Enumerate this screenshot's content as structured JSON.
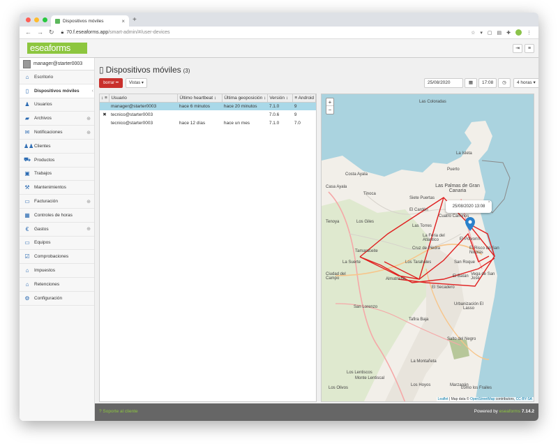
{
  "browser": {
    "tab_title": "Dispositivos móviles",
    "url_host": "70.f.eseaforms.app",
    "url_path": "/smart-admin/#/user-devices"
  },
  "app": {
    "logo": "eseaforms",
    "user": "manager@starter0003"
  },
  "sidebar": {
    "items": [
      {
        "label": "Escritorio",
        "icon": "home-icon",
        "plus": false
      },
      {
        "label": "Dispositivos móviles",
        "icon": "mobile-icon",
        "plus": false,
        "active": true
      },
      {
        "label": "Usuarios",
        "icon": "user-icon",
        "plus": false
      },
      {
        "label": "Archivos",
        "icon": "folder-icon",
        "plus": true
      },
      {
        "label": "Notificaciones",
        "icon": "envelope-icon",
        "plus": true
      },
      {
        "label": "Clientes",
        "icon": "users-icon",
        "plus": false
      },
      {
        "label": "Productos",
        "icon": "cart-icon",
        "plus": false
      },
      {
        "label": "Trabajos",
        "icon": "briefcase-icon",
        "plus": false
      },
      {
        "label": "Mantenimientos",
        "icon": "wrench-icon",
        "plus": false
      },
      {
        "label": "Facturación",
        "icon": "money-icon",
        "plus": true
      },
      {
        "label": "Controles de horas",
        "icon": "calendar-icon",
        "plus": false
      },
      {
        "label": "Gastos",
        "icon": "euro-icon",
        "plus": true
      },
      {
        "label": "Equipos",
        "icon": "laptop-icon",
        "plus": false
      },
      {
        "label": "Comprobaciones",
        "icon": "check-square-icon",
        "plus": false
      },
      {
        "label": "Impuestos",
        "icon": "bank-icon",
        "plus": false
      },
      {
        "label": "Retenciones",
        "icon": "bank-icon",
        "plus": false
      },
      {
        "label": "Configuración",
        "icon": "gear-icon",
        "plus": false
      }
    ]
  },
  "page": {
    "title": "Dispositivos móviles",
    "count": "(3)",
    "delete_label": "borrar ••",
    "views_label": "Vistas ▾",
    "date": "25/08/2020",
    "time": "17:08",
    "range": "4 horas ▾"
  },
  "table": {
    "headers": [
      "Usuario",
      "Último heartbeat",
      "Última geoposición",
      "Versión",
      "Android"
    ],
    "rows": [
      {
        "mark": "",
        "user": "manager@starter0003",
        "heartbeat": "hace 6 minutos",
        "geo": "hace 20 minutos",
        "version": "7.1.0",
        "android": "9",
        "selected": true
      },
      {
        "mark": "✖",
        "user": "tecnico@starter0003",
        "heartbeat": "",
        "geo": "",
        "version": "7.0.6",
        "android": "9",
        "selected": false
      },
      {
        "mark": "",
        "user": "tecnico@starter0003",
        "heartbeat": "hace 12 días",
        "geo": "hace un mes",
        "version": "7.1.0",
        "android": "7.0",
        "selected": false
      }
    ]
  },
  "map": {
    "popup": "25/08/2020 13:08",
    "attribution_leaflet": "Leaflet",
    "attribution_text": "| Map data ©",
    "attribution_osm": "OpenStreetMap",
    "attribution_contrib": "contributors,",
    "attribution_license": "CC-BY-SA",
    "labels": [
      "Las Coloradas",
      "La Isleta",
      "Puerto",
      "Las Palmas de Gran Canaria",
      "El Cardón",
      "Tenoya",
      "Los Giles",
      "Las Torres",
      "La Feria del Atlántico",
      "El Polvorín",
      "Tamaraceite",
      "Cruz de Piedra",
      "El Risco de San Nicolás",
      "San Roque",
      "Los Tarahales",
      "La Suerte",
      "Ciudad del Campo",
      "Almatriche",
      "El Batán",
      "Vega de San José",
      "El Secadero",
      "Urbanización El Lasso",
      "San Lorenzo",
      "Tafira Baja",
      "Salto del Negro",
      "La Montañeta",
      "Los Lentiscos",
      "Monte Lentiscal",
      "Los Hoyos",
      "Marzagán",
      "Los Olivos",
      "Siete Puertas",
      "Cuatro Caminos",
      "Costa Ayala",
      "Tinoca",
      "Lomo los Frailes",
      "Casa Ayala"
    ],
    "route_color": "#e02020",
    "marker_color": "#2a81cb"
  },
  "footer": {
    "support": "Soporte al cliente",
    "powered_prefix": "Powered by",
    "brand": "eseaforms",
    "version": "7.14.2"
  },
  "colors": {
    "brand_green": "#8dc63f",
    "danger": "#c9302c",
    "selected_row": "#a9d8e8",
    "sea": "#aad3df"
  }
}
